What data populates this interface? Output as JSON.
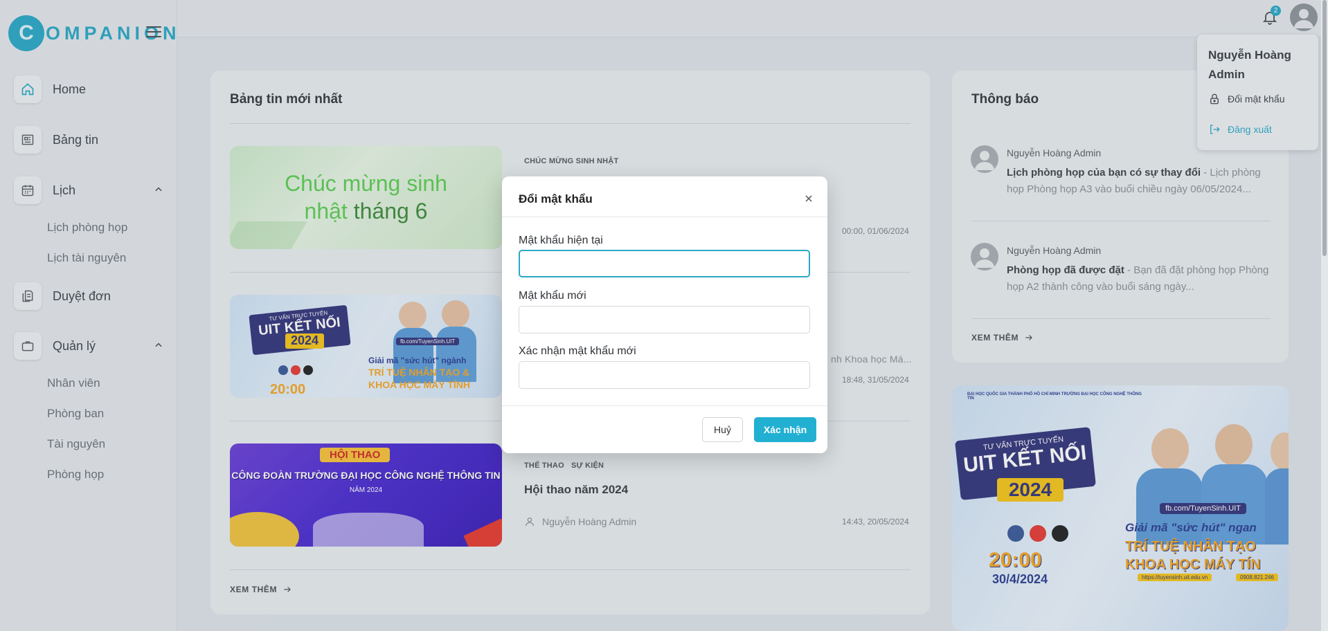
{
  "brand": {
    "logo_text": "OMPANION",
    "logo_mark": "C"
  },
  "sidebar": {
    "items": [
      {
        "label": "Home",
        "icon": "home-icon"
      },
      {
        "label": "Bảng tin",
        "icon": "newspaper-icon"
      },
      {
        "label": "Lịch",
        "icon": "calendar-icon",
        "expanded": true,
        "children": [
          "Lịch phòng họp",
          "Lịch tài nguyên"
        ]
      },
      {
        "label": "Duyệt đơn",
        "icon": "document-icon"
      },
      {
        "label": "Quản lý",
        "icon": "briefcase-icon",
        "expanded": true,
        "children": [
          "Nhân viên",
          "Phòng ban",
          "Tài nguyên",
          "Phòng họp"
        ]
      }
    ]
  },
  "topbar": {
    "notification_count": "2"
  },
  "news": {
    "title": "Bảng tin mới nhất",
    "items": [
      {
        "image_text_1": "Chúc mừng sinh",
        "image_text_2": "nhật",
        "image_text_3": "tháng 6",
        "tags": [
          "CHÚC MỪNG SINH NHẬT"
        ],
        "date": "00:00, 01/06/2024"
      },
      {
        "image_text_1": "TƯ VẤN TRỰC TUYẾN",
        "image_text_2": "UIT KẾT NỐI",
        "image_text_3": "2024",
        "image_text_4": "Giải mã \"sức hút\" ngành",
        "image_text_5": "TRÍ TUỆ NHÂN TẠO &",
        "image_text_6": "KHOA HỌC MÁY TÍNH",
        "image_text_7": "20:00",
        "image_text_8": "fb.com/TuyenSinh.UIT",
        "snippet": "nh Khoa học Má...",
        "date": "18:48, 31/05/2024"
      },
      {
        "image_text_1": "HỘI THAO",
        "image_text_2": "CÔNG ĐOÀN TRƯỜNG ĐẠI HỌC CÔNG NGHỆ THÔNG TIN",
        "image_text_3": "NĂM 2024",
        "tags": [
          "THỂ THAO",
          "SỰ KIỆN"
        ],
        "title": "Hội thao năm 2024",
        "author": "Nguyễn Hoàng Admin",
        "date": "14:43, 20/05/2024"
      }
    ],
    "see_more": "XEM THÊM"
  },
  "notifications": {
    "title": "Thông báo",
    "items": [
      {
        "author": "Nguyễn Hoàng Admin",
        "bold": "Lịch phòng họp của bạn có sự thay đổi",
        "text": " - Lịch phòng họp Phòng họp A3 vào buổi chiều ngày 06/05/2024..."
      },
      {
        "author": "Nguyễn Hoàng Admin",
        "bold": "Phòng họp đã được đặt",
        "text": " - Bạn đã đặt phòng họp Phòng họp A2 thành công vào buổi sáng ngày..."
      }
    ],
    "see_more": "XEM THÊM"
  },
  "banner": {
    "line1": "TƯ VẤN TRỰC TUYẾN",
    "line2": "UIT KẾT NỐI",
    "line3": "2024",
    "line4": "Giải mã \"sức hút\" ngan",
    "line5": "TRÍ TUỆ NHÂN TẠO",
    "line6": "KHOA HỌC MÁY TÍN",
    "time": "20:00",
    "date": "30/4/2024",
    "fb": "fb.com/TuyenSinh.UIT",
    "web": "https://tuyensinh.uit.edu.vn",
    "phone": "0908.821.246",
    "header": "ĐẠI HỌC QUỐC GIA THÀNH PHỐ HỒ CHÍ MINH TRƯỜNG ĐẠI HỌC CÔNG NGHỆ THÔNG TIN"
  },
  "user_menu": {
    "name": "Nguyễn Hoàng Admin",
    "change_password": "Đổi mật khẩu",
    "logout": "Đăng xuất"
  },
  "modal": {
    "title": "Đổi mật khẩu",
    "current_label": "Mật khẩu hiện tại",
    "current_value": "",
    "new_label": "Mật khẩu mới",
    "new_value": "",
    "confirm_label": "Xác nhận mật khẩu mới",
    "confirm_value": "",
    "cancel": "Huỷ",
    "submit": "Xác nhận"
  },
  "colors": {
    "accent": "#22b0d2",
    "logout": "#2aa8c6"
  }
}
